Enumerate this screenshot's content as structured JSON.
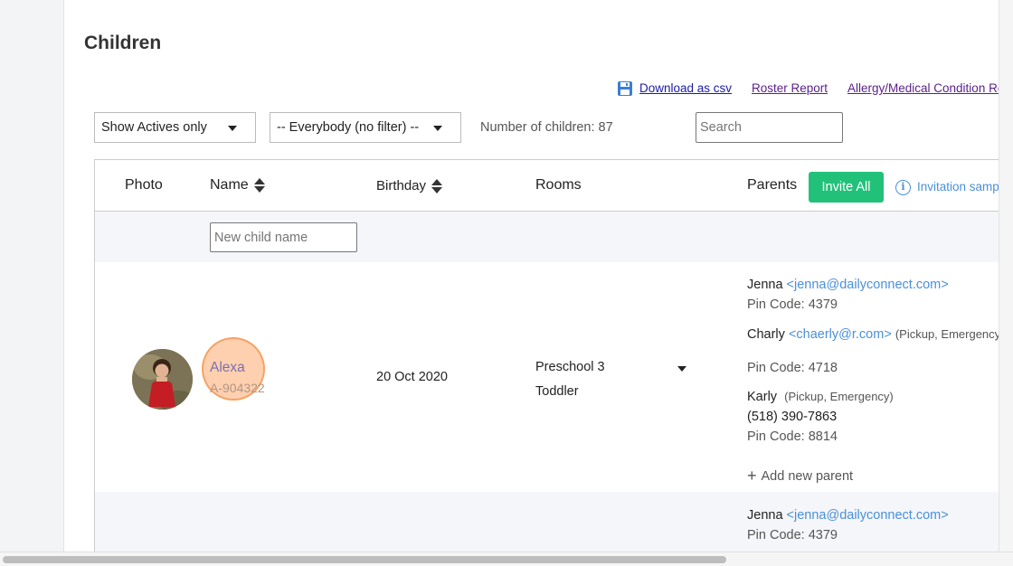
{
  "page": {
    "title": "Children"
  },
  "toolbar": {
    "download_label": "Download as csv",
    "roster_label": "Roster Report",
    "allergy_label": "Allergy/Medical Condition Rep"
  },
  "filters": {
    "status_value": "Show Actives only",
    "group_value": "-- Everybody (no filter) --",
    "count_text": "Number of children: 87",
    "search_placeholder": "Search"
  },
  "table": {
    "headers": {
      "photo": "Photo",
      "name": "Name",
      "birthday": "Birthday",
      "rooms": "Rooms",
      "parents": "Parents"
    },
    "invite_all_label": "Invite All",
    "invitation_sample_label": "Invitation sampl",
    "new_child_placeholder": "New child name",
    "add_parent_label": "Add new parent"
  },
  "rows": [
    {
      "name": "Alexa",
      "code": "A-904322",
      "birthday": "20 Oct 2020",
      "rooms": [
        "Preschool 3",
        "Toddler"
      ],
      "parents": [
        {
          "name": "Jenna",
          "email": "<jenna@dailyconnect.com>",
          "pin": "Pin Code: 4379"
        },
        {
          "name": "Charly",
          "email": "<chaerly@r.com>",
          "roles": "(Pickup, Emergency",
          "pin": "Pin Code: 4718"
        },
        {
          "name": "Karly",
          "roles": "(Pickup, Emergency)",
          "phone": "(518) 390-7863",
          "pin": "Pin Code: 8814"
        }
      ]
    },
    {
      "parents": [
        {
          "name": "Jenna",
          "email": "<jenna@dailyconnect.com>",
          "pin": "Pin Code: 4379"
        }
      ]
    }
  ],
  "colors": {
    "invite_button": "#22c17a",
    "link_blue": "#4a90d9",
    "row_alt": "#f4f6fa",
    "highlight": "#f5a46a"
  },
  "icons": {
    "download": "floppy-disk-icon",
    "sort": "sort-icon",
    "info": "info-icon",
    "caret": "chevron-down-icon",
    "add": "plus-icon"
  }
}
